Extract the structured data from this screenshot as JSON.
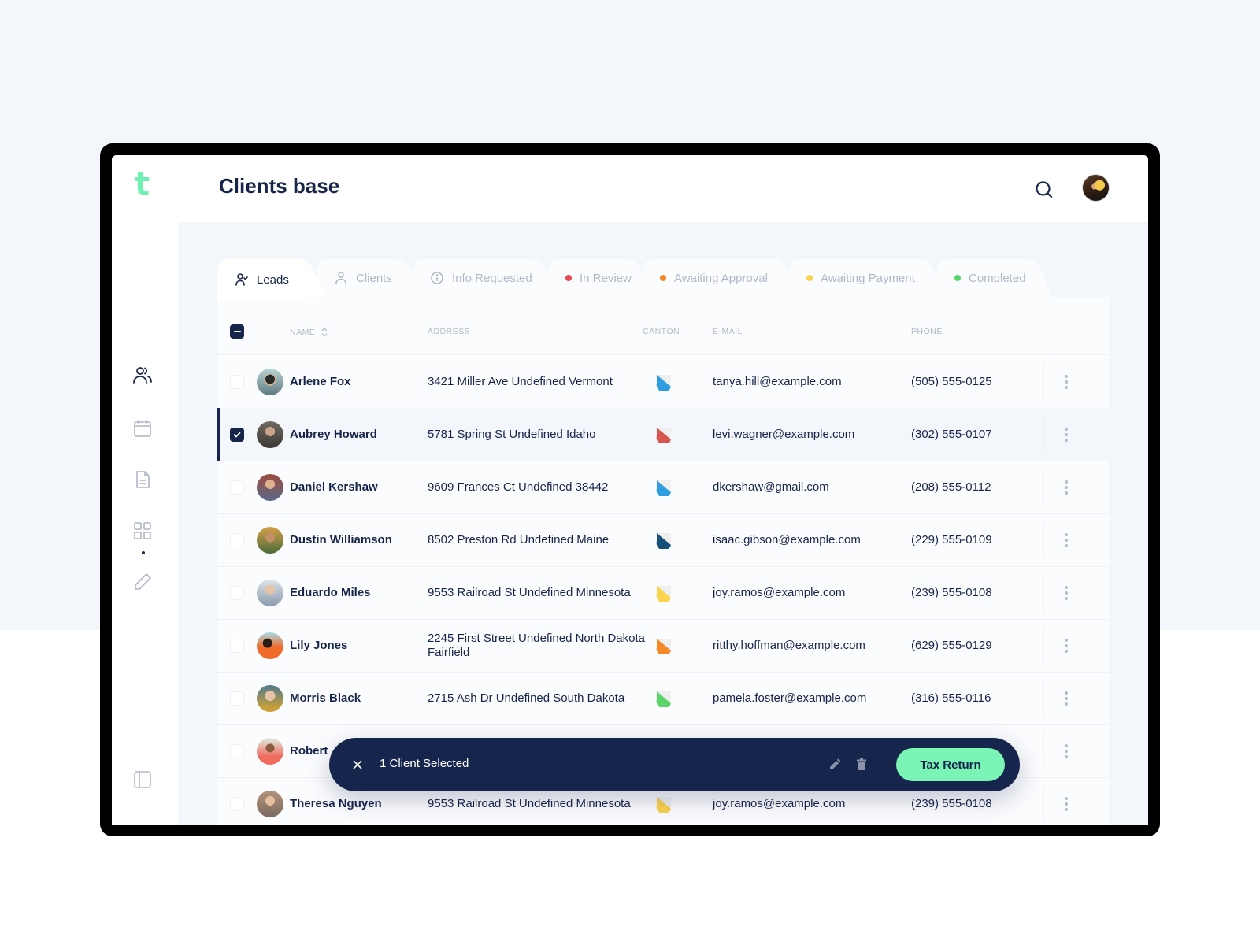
{
  "app": {
    "logo": "t",
    "title": "Clients base"
  },
  "header": {
    "search_icon": "search-icon",
    "avatar": "user-avatar"
  },
  "sidebar": {
    "items": [
      {
        "icon": "users-icon",
        "active": true
      },
      {
        "icon": "calendar-icon",
        "active": false
      },
      {
        "icon": "document-icon",
        "active": false
      },
      {
        "icon": "grid-icon",
        "active": false
      },
      {
        "icon": "pencil-icon",
        "active": false
      }
    ],
    "bottom_icon": "sidebar-toggle-icon"
  },
  "tabs": [
    {
      "label": "Leads",
      "icon": "user-check-icon",
      "active": true
    },
    {
      "label": "Clients",
      "icon": "user-icon",
      "active": false
    },
    {
      "label": "Info Requested",
      "icon": "info-icon",
      "active": false
    },
    {
      "label": "In Review",
      "dot": "#e5484d",
      "active": false
    },
    {
      "label": "Awaiting Approval",
      "dot": "#f5892a",
      "active": false
    },
    {
      "label": "Awaiting Payment",
      "dot": "#fcd34d",
      "active": false
    },
    {
      "label": "Completed",
      "dot": "#5bd46b",
      "active": false
    }
  ],
  "table": {
    "columns": {
      "name": "NAME",
      "address": "ADDRESS",
      "canton": "CANTON",
      "email": "E-MAIL",
      "phone": "PHONE"
    },
    "rows": [
      {
        "name": "Arlene Fox",
        "address": "3421 Miller Ave Undefined Vermont",
        "canton_color": "#2f9ee0",
        "email": "tanya.hill@example.com",
        "phone": "(505) 555-0125",
        "selected": false
      },
      {
        "name": "Aubrey Howard",
        "address": "5781 Spring St Undefined Idaho",
        "canton_color": "#d9534f",
        "email": "levi.wagner@example.com",
        "phone": "(302) 555-0107",
        "selected": true
      },
      {
        "name": "Daniel Kershaw",
        "address": "9609 Frances Ct Undefined 38442",
        "canton_color": "#2f9ee0",
        "email": "dkershaw@gmail.com",
        "phone": "(208) 555-0112",
        "selected": false
      },
      {
        "name": "Dustin Williamson",
        "address": "8502 Preston Rd Undefined Maine",
        "canton_color": "#16507a",
        "email": "isaac.gibson@example.com",
        "phone": "(229) 555-0109",
        "selected": false
      },
      {
        "name": "Eduardo Miles",
        "address": "9553 Railroad St Undefined Minnesota",
        "canton_color": "#fcd34d",
        "email": "joy.ramos@example.com",
        "phone": "(239) 555-0108",
        "selected": false
      },
      {
        "name": "Lily Jones",
        "address": "2245 First Street Undefined North Dakota Fairfield",
        "canton_color": "#f5892a",
        "email": "ritthy.hoffman@example.com",
        "phone": "(629) 555-0129",
        "selected": false
      },
      {
        "name": "Morris Black",
        "address": "2715 Ash Dr Undefined South Dakota",
        "canton_color": "#5bd46b",
        "email": "pamela.foster@example.com",
        "phone": "(316) 555-0116",
        "selected": false
      },
      {
        "name": "Robert",
        "address": "",
        "canton_color": "",
        "email": "",
        "phone": "",
        "selected": false
      },
      {
        "name": "Theresa Nguyen",
        "address": "9553 Railroad St Undefined Minnesota",
        "canton_color": "#fcd34d",
        "email": "joy.ramos@example.com",
        "phone": "(239) 555-0108",
        "selected": false
      }
    ]
  },
  "action_bar": {
    "selection_label": "1 Client Selected",
    "primary_button": "Tax Return"
  },
  "colors": {
    "brand": "#6ef0b2",
    "navy": "#16254c",
    "accent_button": "#7af5b6"
  }
}
